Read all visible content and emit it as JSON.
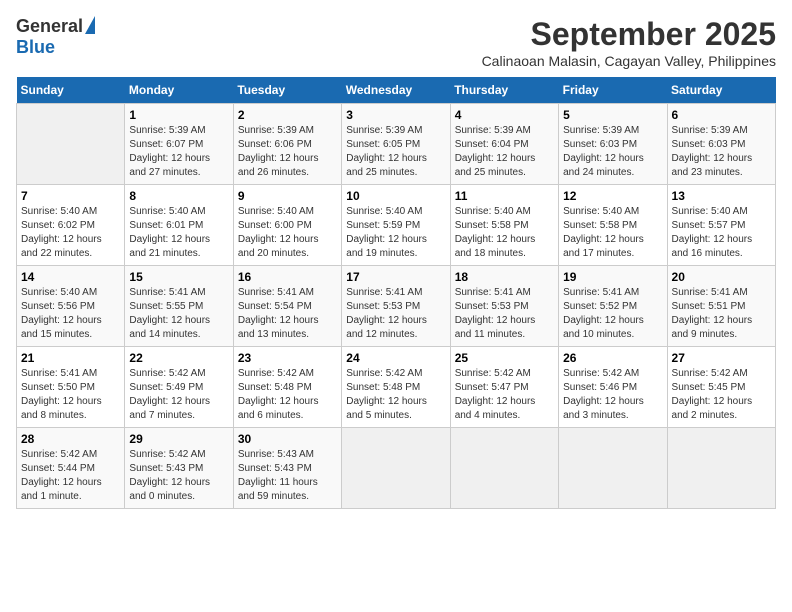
{
  "header": {
    "logo_general": "General",
    "logo_blue": "Blue",
    "month_title": "September 2025",
    "location": "Calinaoan Malasin, Cagayan Valley, Philippines"
  },
  "days_of_week": [
    "Sunday",
    "Monday",
    "Tuesday",
    "Wednesday",
    "Thursday",
    "Friday",
    "Saturday"
  ],
  "weeks": [
    [
      {
        "day": "",
        "info": ""
      },
      {
        "day": "1",
        "info": "Sunrise: 5:39 AM\nSunset: 6:07 PM\nDaylight: 12 hours\nand 27 minutes."
      },
      {
        "day": "2",
        "info": "Sunrise: 5:39 AM\nSunset: 6:06 PM\nDaylight: 12 hours\nand 26 minutes."
      },
      {
        "day": "3",
        "info": "Sunrise: 5:39 AM\nSunset: 6:05 PM\nDaylight: 12 hours\nand 25 minutes."
      },
      {
        "day": "4",
        "info": "Sunrise: 5:39 AM\nSunset: 6:04 PM\nDaylight: 12 hours\nand 25 minutes."
      },
      {
        "day": "5",
        "info": "Sunrise: 5:39 AM\nSunset: 6:03 PM\nDaylight: 12 hours\nand 24 minutes."
      },
      {
        "day": "6",
        "info": "Sunrise: 5:39 AM\nSunset: 6:03 PM\nDaylight: 12 hours\nand 23 minutes."
      }
    ],
    [
      {
        "day": "7",
        "info": "Sunrise: 5:40 AM\nSunset: 6:02 PM\nDaylight: 12 hours\nand 22 minutes."
      },
      {
        "day": "8",
        "info": "Sunrise: 5:40 AM\nSunset: 6:01 PM\nDaylight: 12 hours\nand 21 minutes."
      },
      {
        "day": "9",
        "info": "Sunrise: 5:40 AM\nSunset: 6:00 PM\nDaylight: 12 hours\nand 20 minutes."
      },
      {
        "day": "10",
        "info": "Sunrise: 5:40 AM\nSunset: 5:59 PM\nDaylight: 12 hours\nand 19 minutes."
      },
      {
        "day": "11",
        "info": "Sunrise: 5:40 AM\nSunset: 5:58 PM\nDaylight: 12 hours\nand 18 minutes."
      },
      {
        "day": "12",
        "info": "Sunrise: 5:40 AM\nSunset: 5:58 PM\nDaylight: 12 hours\nand 17 minutes."
      },
      {
        "day": "13",
        "info": "Sunrise: 5:40 AM\nSunset: 5:57 PM\nDaylight: 12 hours\nand 16 minutes."
      }
    ],
    [
      {
        "day": "14",
        "info": "Sunrise: 5:40 AM\nSunset: 5:56 PM\nDaylight: 12 hours\nand 15 minutes."
      },
      {
        "day": "15",
        "info": "Sunrise: 5:41 AM\nSunset: 5:55 PM\nDaylight: 12 hours\nand 14 minutes."
      },
      {
        "day": "16",
        "info": "Sunrise: 5:41 AM\nSunset: 5:54 PM\nDaylight: 12 hours\nand 13 minutes."
      },
      {
        "day": "17",
        "info": "Sunrise: 5:41 AM\nSunset: 5:53 PM\nDaylight: 12 hours\nand 12 minutes."
      },
      {
        "day": "18",
        "info": "Sunrise: 5:41 AM\nSunset: 5:53 PM\nDaylight: 12 hours\nand 11 minutes."
      },
      {
        "day": "19",
        "info": "Sunrise: 5:41 AM\nSunset: 5:52 PM\nDaylight: 12 hours\nand 10 minutes."
      },
      {
        "day": "20",
        "info": "Sunrise: 5:41 AM\nSunset: 5:51 PM\nDaylight: 12 hours\nand 9 minutes."
      }
    ],
    [
      {
        "day": "21",
        "info": "Sunrise: 5:41 AM\nSunset: 5:50 PM\nDaylight: 12 hours\nand 8 minutes."
      },
      {
        "day": "22",
        "info": "Sunrise: 5:42 AM\nSunset: 5:49 PM\nDaylight: 12 hours\nand 7 minutes."
      },
      {
        "day": "23",
        "info": "Sunrise: 5:42 AM\nSunset: 5:48 PM\nDaylight: 12 hours\nand 6 minutes."
      },
      {
        "day": "24",
        "info": "Sunrise: 5:42 AM\nSunset: 5:48 PM\nDaylight: 12 hours\nand 5 minutes."
      },
      {
        "day": "25",
        "info": "Sunrise: 5:42 AM\nSunset: 5:47 PM\nDaylight: 12 hours\nand 4 minutes."
      },
      {
        "day": "26",
        "info": "Sunrise: 5:42 AM\nSunset: 5:46 PM\nDaylight: 12 hours\nand 3 minutes."
      },
      {
        "day": "27",
        "info": "Sunrise: 5:42 AM\nSunset: 5:45 PM\nDaylight: 12 hours\nand 2 minutes."
      }
    ],
    [
      {
        "day": "28",
        "info": "Sunrise: 5:42 AM\nSunset: 5:44 PM\nDaylight: 12 hours\nand 1 minute."
      },
      {
        "day": "29",
        "info": "Sunrise: 5:42 AM\nSunset: 5:43 PM\nDaylight: 12 hours\nand 0 minutes."
      },
      {
        "day": "30",
        "info": "Sunrise: 5:43 AM\nSunset: 5:43 PM\nDaylight: 11 hours\nand 59 minutes."
      },
      {
        "day": "",
        "info": ""
      },
      {
        "day": "",
        "info": ""
      },
      {
        "day": "",
        "info": ""
      },
      {
        "day": "",
        "info": ""
      }
    ]
  ]
}
